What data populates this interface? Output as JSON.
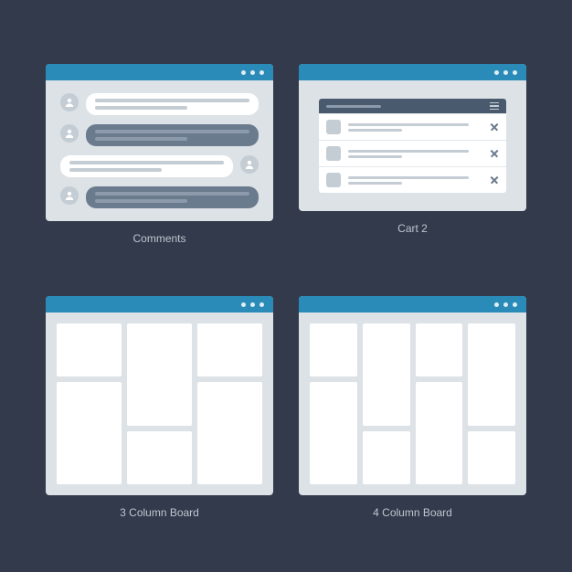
{
  "colors": {
    "background": "#323a4b",
    "titlebar": "#2a8bb8",
    "window_bg": "#dde2e6",
    "bubble_dark": "#6b7b8e",
    "tile": "#ffffff",
    "caption": "#bfc7d1"
  },
  "windows": {
    "comments": {
      "caption": "Comments",
      "messages": [
        {
          "side": "left",
          "style": "light"
        },
        {
          "side": "left",
          "style": "dark"
        },
        {
          "side": "right",
          "style": "light"
        },
        {
          "side": "left",
          "style": "dark"
        }
      ]
    },
    "cart": {
      "caption": "Cart 2",
      "item_count": 3
    },
    "board3": {
      "caption": "3 Column Board",
      "tiles": 6
    },
    "board4": {
      "caption": "4 Column Board",
      "tiles": 8
    }
  }
}
